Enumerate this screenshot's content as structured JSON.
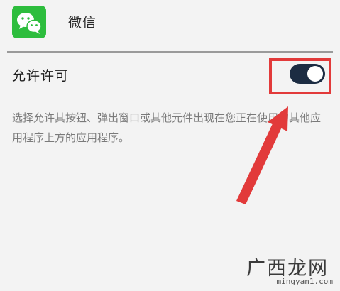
{
  "app": {
    "name": "微信",
    "icon": "wechat-icon",
    "icon_color": "#2dbd3d"
  },
  "permission": {
    "label": "允许许可",
    "enabled": true,
    "toggle_color": "#1c2c42"
  },
  "description": "选择允许其按钮、弹出窗口或其他元件出现在您正在使用的其他应用程序上方的应用程序。",
  "annotation": {
    "color": "#e23a3a"
  },
  "watermark": {
    "text": "广西龙网",
    "url": "mingyan1.com"
  }
}
